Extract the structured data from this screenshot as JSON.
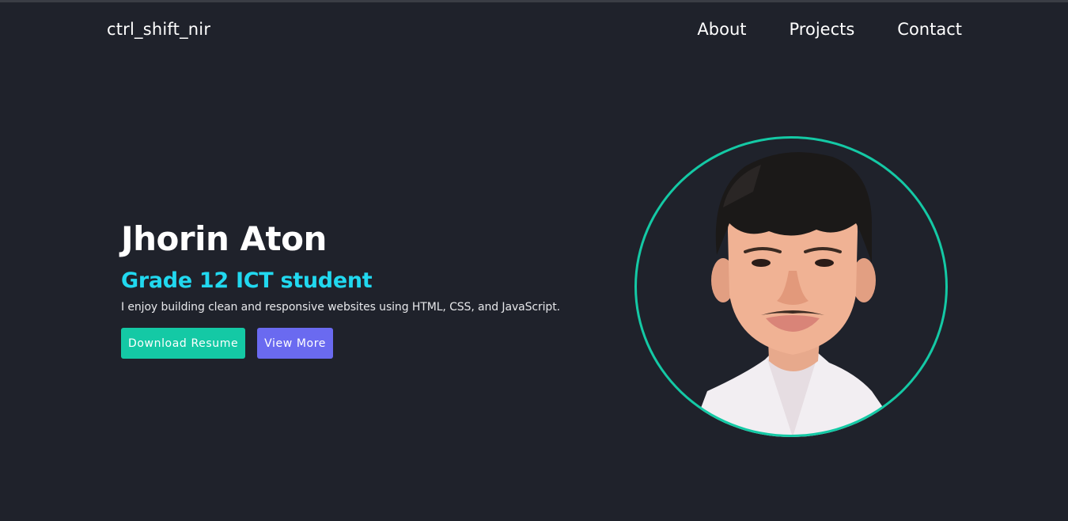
{
  "colors": {
    "background": "#1f222b",
    "accent_teal": "#14c9a5",
    "accent_cyan": "#21d8ef",
    "accent_purple": "#6a6af0"
  },
  "nav": {
    "logo": "ctrl_shift_nir",
    "links": [
      {
        "label": "About"
      },
      {
        "label": "Projects"
      },
      {
        "label": "Contact"
      }
    ]
  },
  "hero": {
    "name": "Jhorin Aton",
    "role": "Grade 12 ICT student",
    "description": "I enjoy building clean and responsive websites using HTML, CSS, and JavaScript.",
    "buttons": {
      "download_resume": "Download Resume",
      "view_more": "View More"
    }
  }
}
